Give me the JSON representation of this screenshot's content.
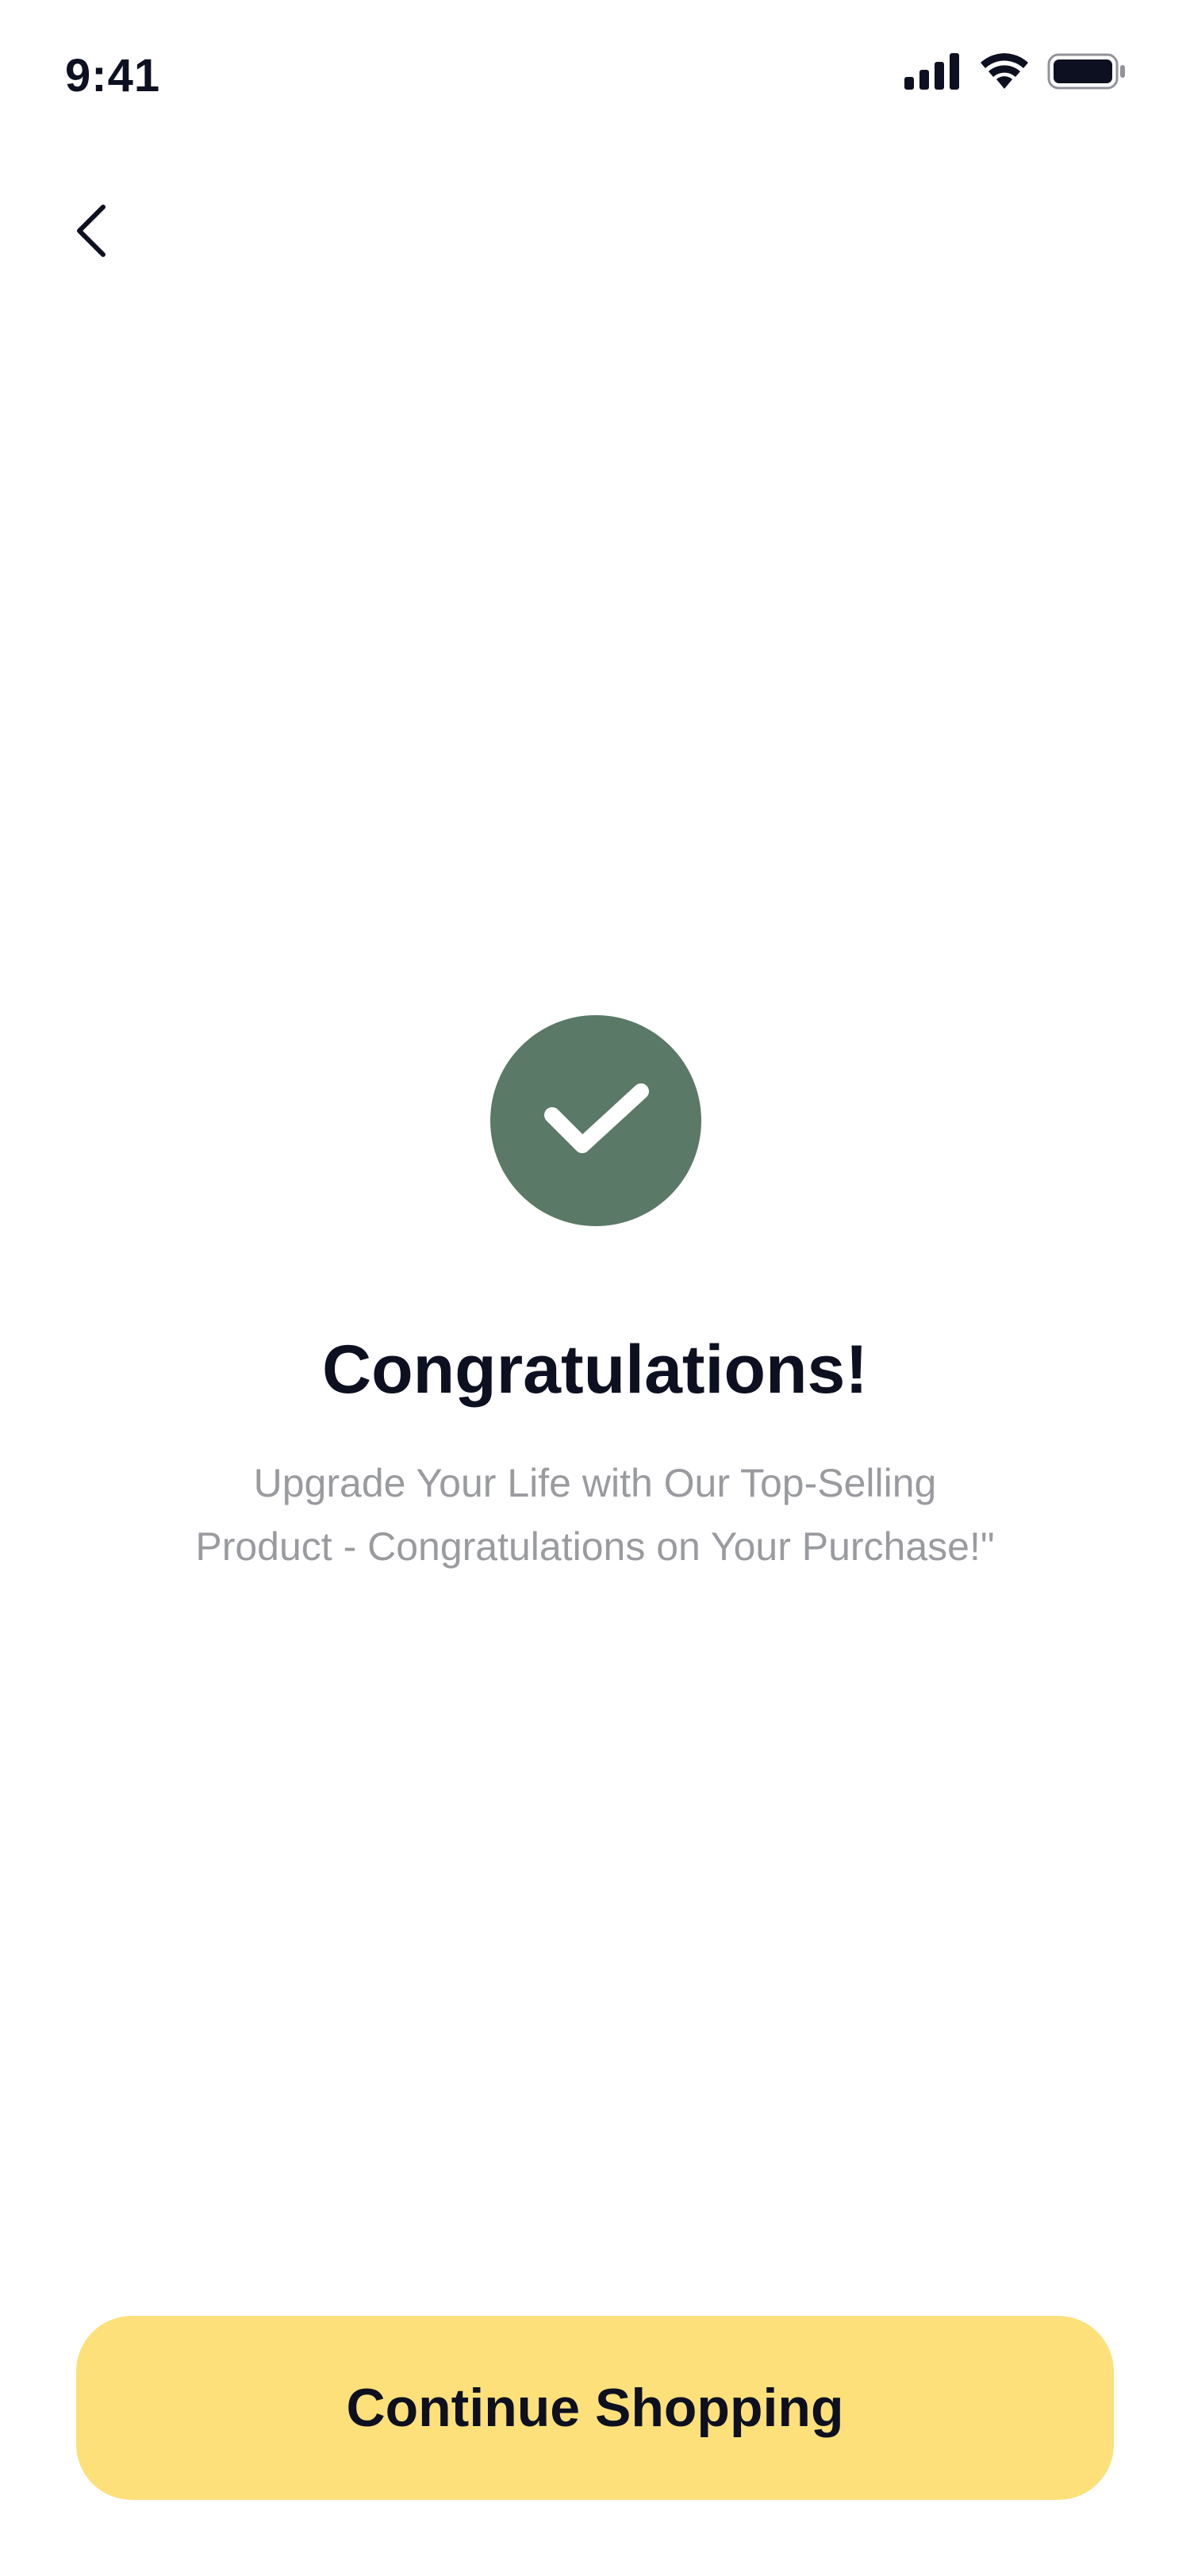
{
  "status_bar": {
    "time": "9:41",
    "icons": [
      "cellular-signal-icon",
      "wifi-icon",
      "battery-icon"
    ]
  },
  "navigation": {
    "back_icon": "chevron-left-icon"
  },
  "success": {
    "icon": "checkmark-icon",
    "title": "Congratulations!",
    "subtitle_lines": [
      "Upgrade Your Life with Our Top-Selling",
      "Product - Congratulations on Your Purchase!\""
    ]
  },
  "actions": {
    "continue_label": "Continue Shopping"
  },
  "colors": {
    "accent_green": "#5a7967",
    "button_yellow": "#fde07a",
    "text_dark": "#0d1020",
    "text_muted": "#9a9b9f",
    "background": "#ffffff"
  }
}
